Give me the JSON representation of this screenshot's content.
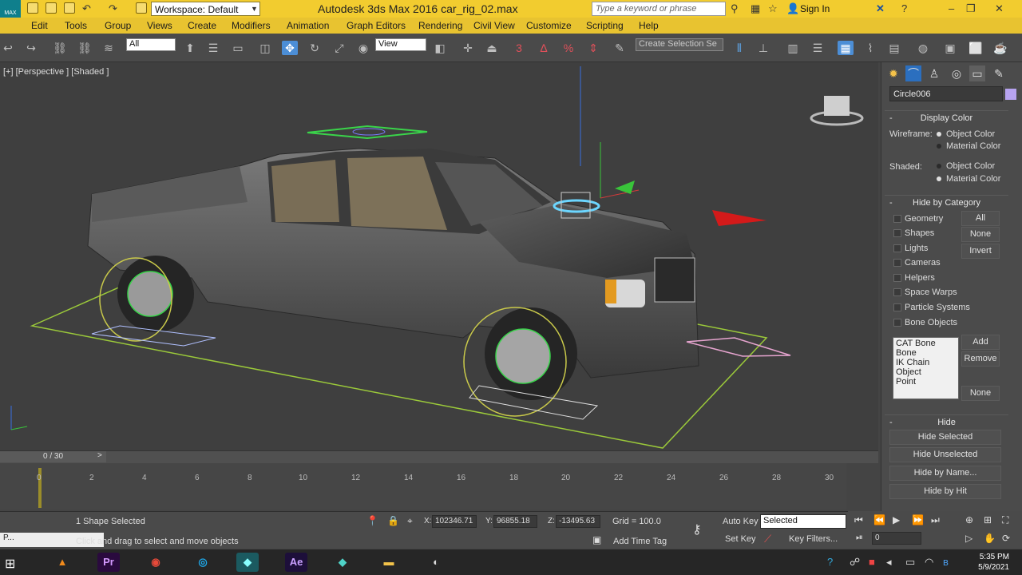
{
  "titlebar": {
    "workspace": "Workspace: Default",
    "title": "Autodesk 3ds Max 2016    car_rig_02.max",
    "search_placeholder": "Type a keyword or phrase",
    "signin": "Sign In",
    "logo": "MAX"
  },
  "menus": [
    "Edit",
    "Tools",
    "Group",
    "Views",
    "Create",
    "Modifiers",
    "Animation",
    "Graph Editors",
    "Rendering",
    "Civil View",
    "Customize",
    "Scripting",
    "Help"
  ],
  "toolbar": {
    "filter": "All",
    "refcoord": "View",
    "selset": "Create Selection Se"
  },
  "viewport": {
    "label": "[+] [Perspective ] [Shaded ]"
  },
  "panel": {
    "objname": "Circle006",
    "display_color": "Display Color",
    "wireframe_label": "Wireframe:",
    "shaded_label": "Shaded:",
    "object_color": "Object Color",
    "material_color": "Material Color",
    "hide_by_category": "Hide by Category",
    "categories": [
      "Geometry",
      "Shapes",
      "Lights",
      "Cameras",
      "Helpers",
      "Space Warps",
      "Particle Systems",
      "Bone Objects"
    ],
    "cat_buttons": [
      "All",
      "None",
      "Invert"
    ],
    "list_items": [
      "CAT Bone",
      "Bone",
      "IK Chain Object",
      "Point"
    ],
    "list_add": "Add",
    "list_remove": "Remove",
    "list_none": "None",
    "hide": "Hide",
    "hide_buttons": [
      "Hide Selected",
      "Hide Unselected",
      "Hide by Name...",
      "Hide by Hit"
    ]
  },
  "timeline": {
    "slider": "0 / 30",
    "ticks": [
      "0",
      "2",
      "4",
      "6",
      "8",
      "10",
      "12",
      "14",
      "16",
      "18",
      "20",
      "22",
      "24",
      "26",
      "28",
      "30"
    ]
  },
  "status": {
    "selected": "1 Shape Selected",
    "prompt": "Click and drag to select and move objects",
    "x_label": "X:",
    "x": "102346.71",
    "y_label": "Y:",
    "y": "96855.18",
    "z_label": "Z:",
    "z": "-13495.63",
    "grid": "Grid = 100.0",
    "autokey": "Auto Key",
    "setkey": "Set Key",
    "keymode": "Selected",
    "keyfilters": "Key Filters...",
    "addtimetag": "Add Time Tag",
    "frame": "0"
  },
  "taskbar": {
    "time": "5:35 PM",
    "date": "5/9/2021",
    "pr": "Pr",
    "ae": "Ae",
    "p_label": "P..."
  }
}
